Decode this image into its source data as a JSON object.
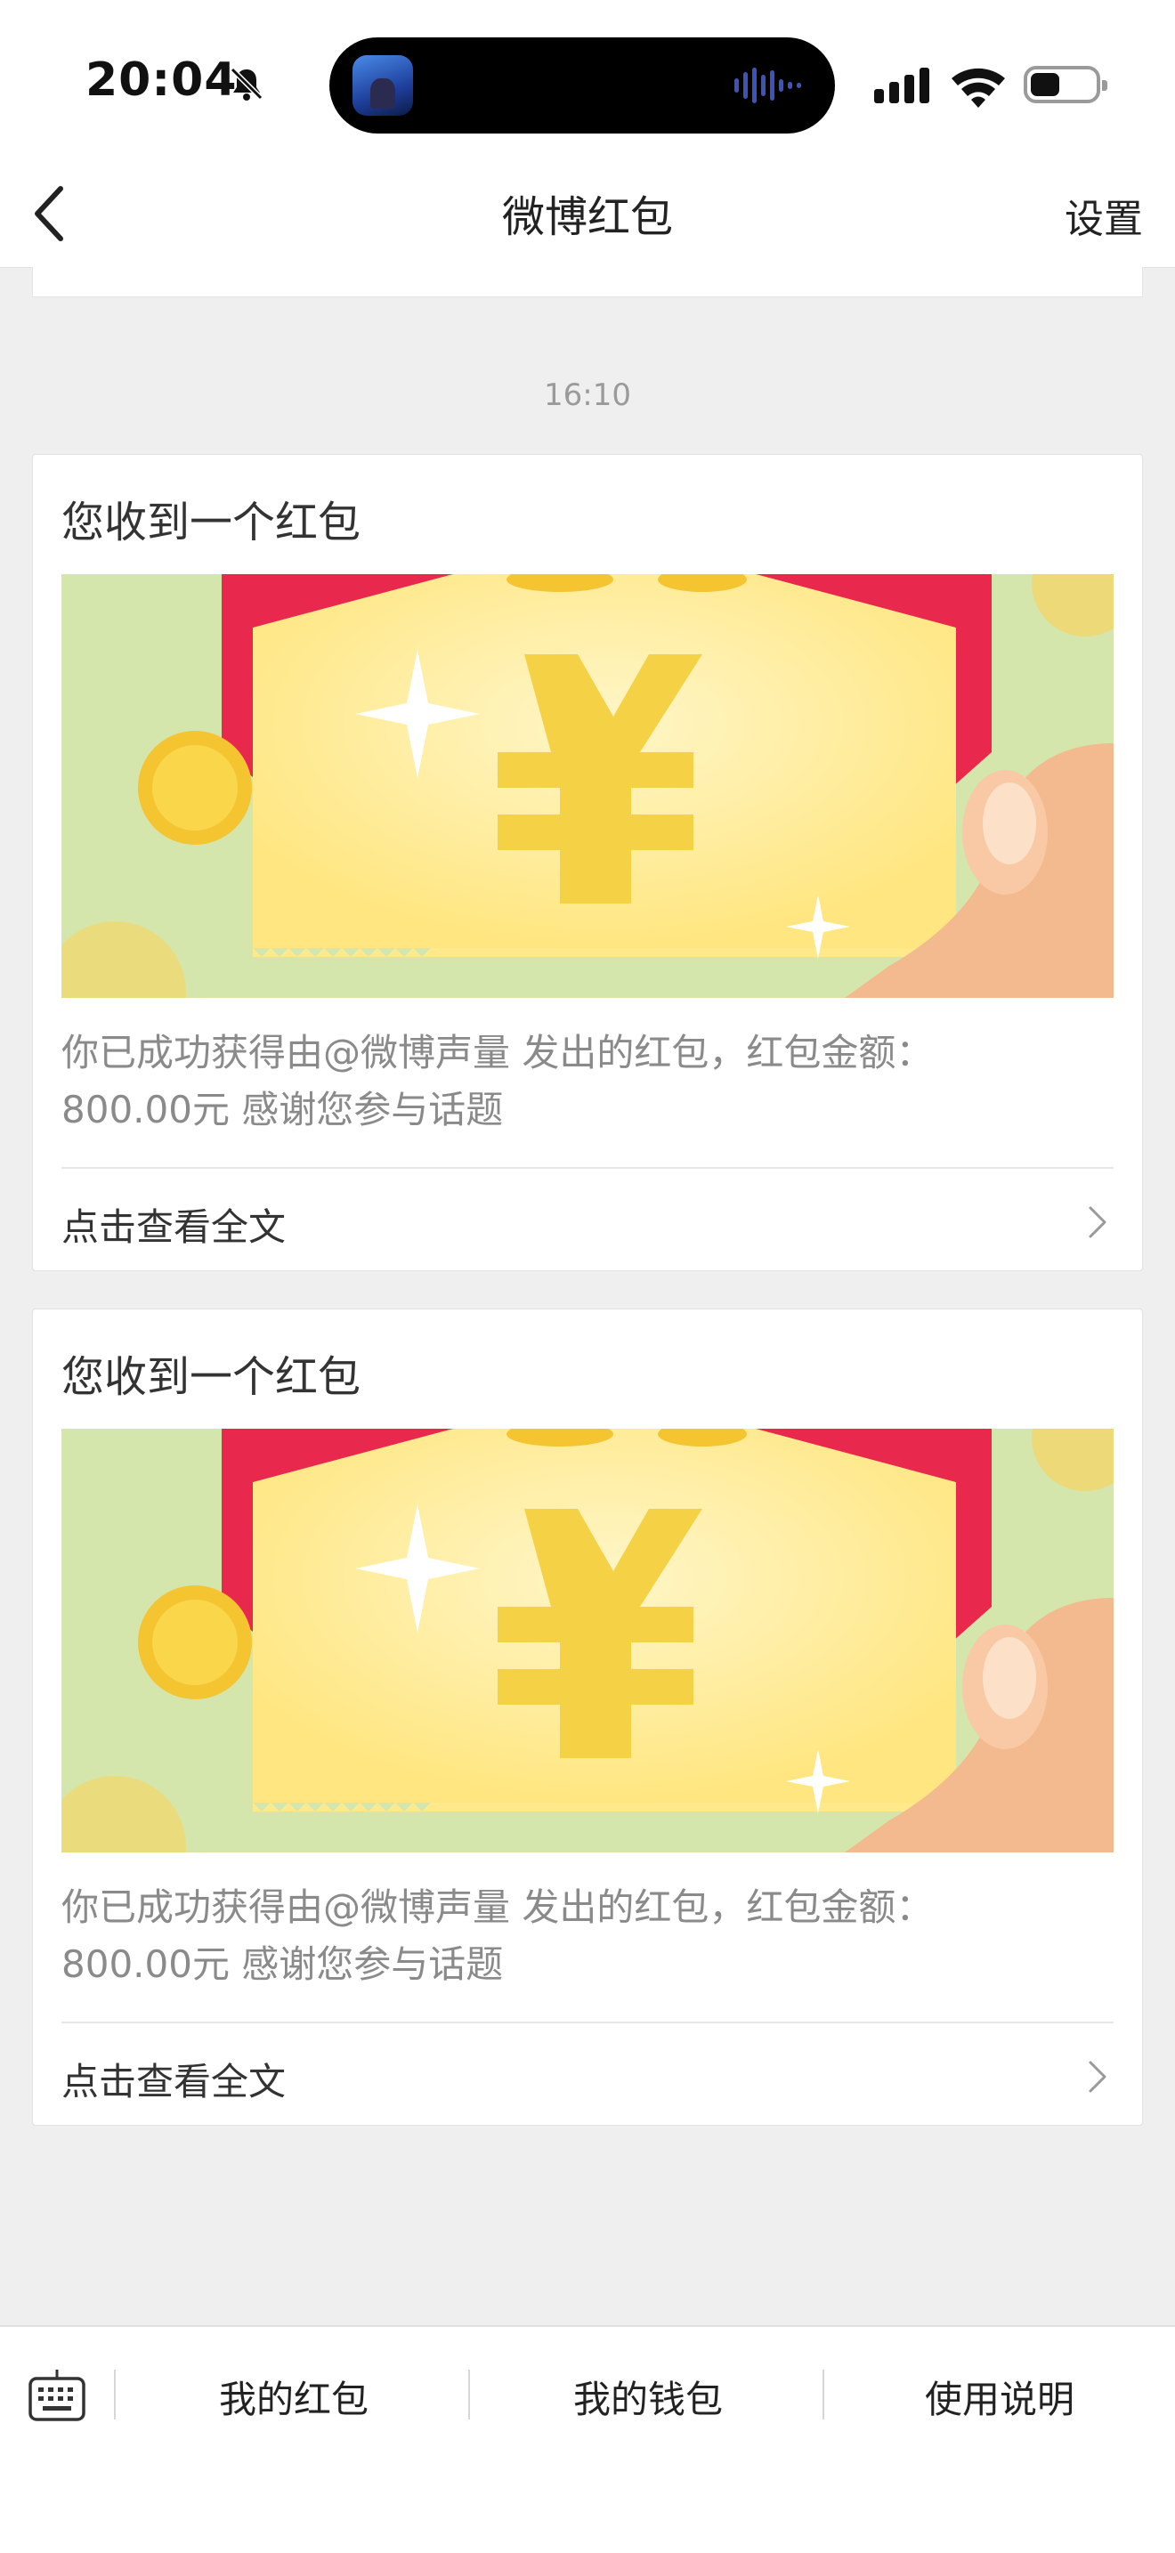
{
  "status_bar": {
    "time": "20:04",
    "signal_bars": 4,
    "battery_level": 0.3
  },
  "nav": {
    "title": "微博红包",
    "right_action": "设置"
  },
  "timestamp": "16:10",
  "messages": [
    {
      "title": "您收到一个红包",
      "body_line1": "你已成功获得由@微博声量 发出的红包，红包金额：",
      "body_line2": "800.00元 感谢您参与话题",
      "link": "点击查看全文"
    },
    {
      "title": "您收到一个红包",
      "body_line1": "你已成功获得由@微博声量 发出的红包，红包金额：",
      "body_line2": "800.00元 感谢您参与话题",
      "link": "点击查看全文"
    }
  ],
  "bottom_menu": {
    "tab1": "我的红包",
    "tab2": "我的钱包",
    "tab3": "使用说明"
  },
  "icons": {
    "back": "chevron-left-icon",
    "mute": "bell-slash-icon",
    "wifi": "wifi-icon",
    "keyboard": "keyboard-icon",
    "more": "chevron-right-icon"
  },
  "colors": {
    "background": "#efefef",
    "card": "#ffffff",
    "red_envelope": "#e8284c",
    "ticket": "#ffe98a",
    "green_bg": "#cfe3a6"
  }
}
